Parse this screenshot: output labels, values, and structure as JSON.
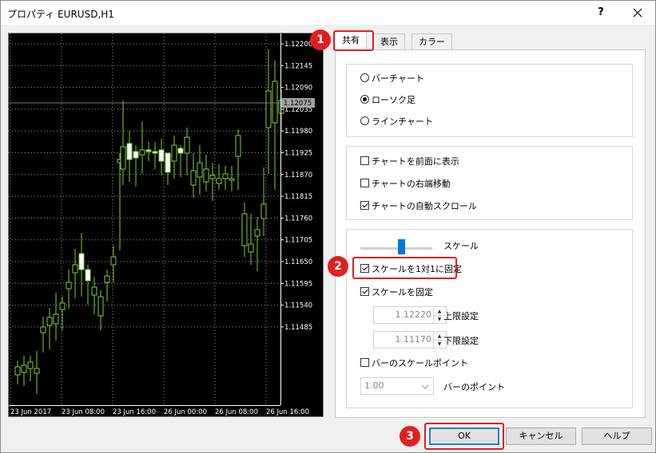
{
  "window": {
    "title": "プロパティ EURUSD,H1",
    "help_glyph": "?",
    "close_glyph": "✕"
  },
  "chart": {
    "current_price": "1.12075",
    "price_labels": [
      "1.12200",
      "1.12145",
      "1.12090",
      "1.12035",
      "1.11980",
      "1.11925",
      "1.11870",
      "1.11815",
      "1.11760",
      "1.11705",
      "1.11650",
      "1.11595",
      "1.11540",
      "1.11485"
    ],
    "time_labels": [
      "23 Jun 2017",
      "23 Jun 08:00",
      "23 Jun 16:00",
      "26 Jun 00:00",
      "26 Jun 08:00",
      "26 Jun 16:00"
    ],
    "colors": {
      "background": "#000000",
      "bull": "#ffffff",
      "wick": "#7cd13b",
      "grid": "#9a9a9a",
      "price_badge": "#a0a0a0"
    }
  },
  "tabs": [
    {
      "label": "共有"
    },
    {
      "label": "表示"
    },
    {
      "label": "カラー"
    }
  ],
  "chart_type": {
    "options": [
      {
        "label": "バーチャート",
        "selected": false
      },
      {
        "label": "ローソク足",
        "selected": true
      },
      {
        "label": "ラインチャート",
        "selected": false
      }
    ]
  },
  "chart_opts": [
    {
      "label": "チャートを前面に表示",
      "checked": false
    },
    {
      "label": "チャートの右端移動",
      "checked": false
    },
    {
      "label": "チャートの自動スクロール",
      "checked": true
    }
  ],
  "scale": {
    "slider_label": "スケール",
    "fix_1to1": {
      "label": "スケールを1対1に固定",
      "checked": true
    },
    "fixed": {
      "label": "スケールを固定",
      "checked": true
    },
    "upper": {
      "value": "1.12220",
      "label": "上限設定"
    },
    "lower": {
      "value": "1.11170",
      "label": "下限設定"
    },
    "bar_scale": {
      "label": "バーのスケールポイント",
      "checked": false
    },
    "bar_points": {
      "value": "1.00",
      "label": "バーのポイント"
    }
  },
  "buttons": {
    "ok": "OK",
    "cancel": "キャンセル",
    "help": "ヘルプ"
  },
  "badges": [
    "1",
    "2",
    "3"
  ],
  "colors": {
    "highlight": "#e02020",
    "accent": "#2f78d0",
    "slider_thumb": "#0078d7"
  }
}
